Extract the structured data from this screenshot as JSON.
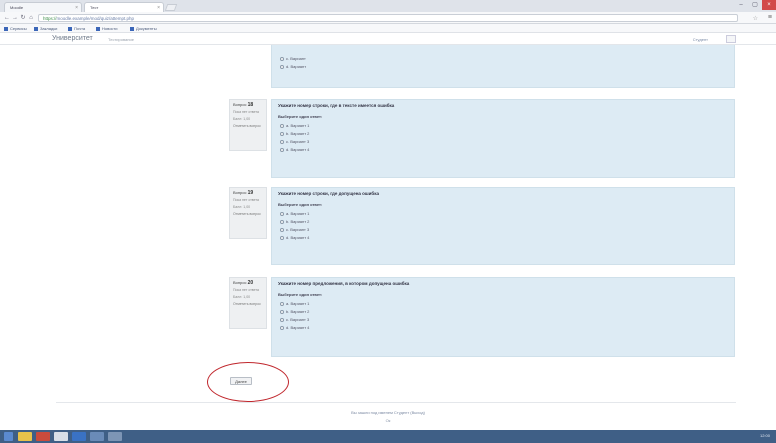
{
  "browser": {
    "tabs": [
      {
        "label": "Moodle"
      },
      {
        "label": "Тест"
      }
    ],
    "url_scheme": "https://",
    "url_rest": "moodle.example/mod/quiz/attempt.php",
    "bookmarks": [
      "Сервисы",
      "Закладки",
      "Почта",
      "Новости",
      "Документы"
    ]
  },
  "site": {
    "logo": "Университет",
    "subtitle": "Тестирование",
    "user": "Студент"
  },
  "questions": [
    {
      "number": "18",
      "label": "Вопрос",
      "status": "Пока нет ответа",
      "score": "Балл: 1,00",
      "flag": "Отметить вопрос",
      "text": "Укажите номер строки, где в тексте имеется ошибка",
      "prompt": "Выберите один ответ:",
      "options": [
        "a. Вариант 1",
        "b. Вариант 2",
        "c. Вариант 3",
        "d. Вариант 4"
      ]
    },
    {
      "number": "19",
      "label": "Вопрос",
      "status": "Пока нет ответа",
      "score": "Балл: 1,00",
      "flag": "Отметить вопрос",
      "text": "Укажите номер строки, где допущена ошибка",
      "prompt": "Выберите один ответ:",
      "options": [
        "a. Вариант 1",
        "b. Вариант 2",
        "c. Вариант 3",
        "d. Вариант 4"
      ]
    },
    {
      "number": "20",
      "label": "Вопрос",
      "status": "Пока нет ответа",
      "score": "Балл: 1,00",
      "flag": "Отметить вопрос",
      "text": "Укажите номер предложения, в котором допущена ошибка",
      "prompt": "Выберите один ответ:",
      "options": [
        "a. Вариант 1",
        "b. Вариант 2",
        "c. Вариант 3",
        "d. Вариант 4"
      ]
    }
  ],
  "partial_options": [
    "c. Вариант",
    "d. Вариант"
  ],
  "submit_label": "Далее",
  "footer": {
    "text": "Вы зашли под именем Студент (Выход)",
    "sub": "Ок"
  },
  "taskbar": {
    "tray": "12:00"
  }
}
